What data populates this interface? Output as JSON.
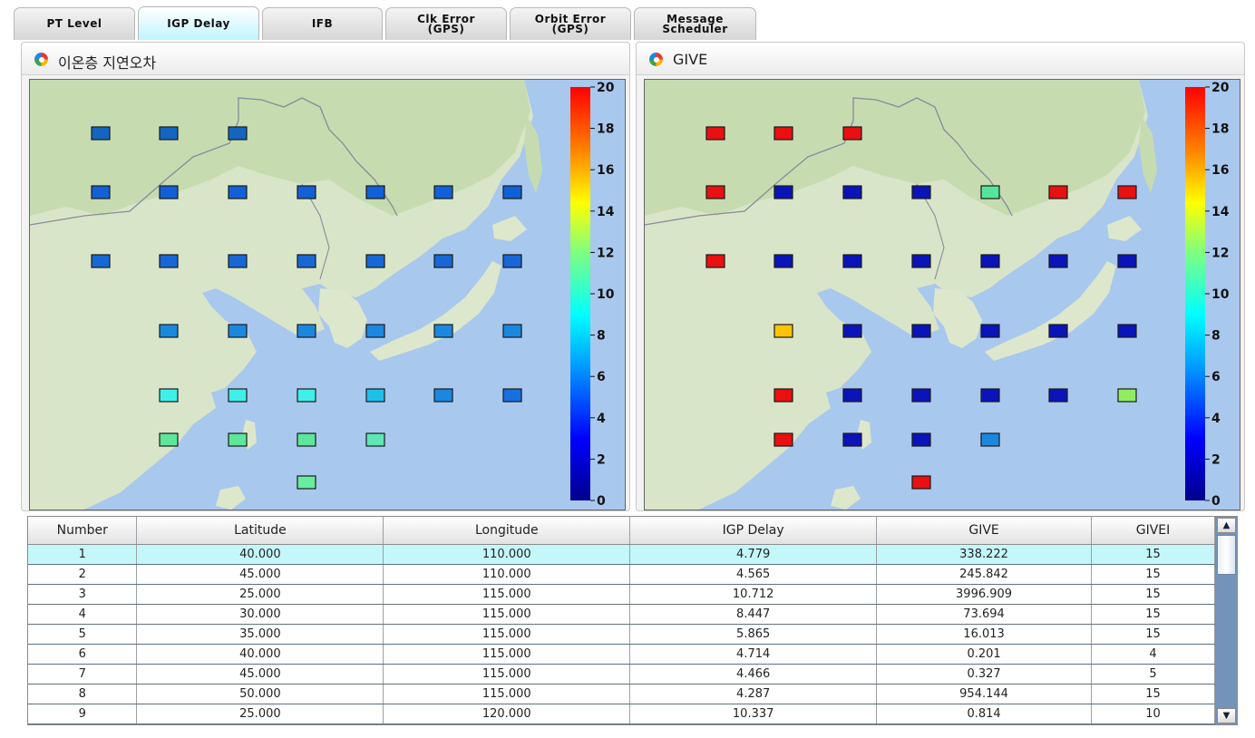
{
  "tabs": [
    {
      "label": "PT Level",
      "active": false
    },
    {
      "label": "IGP Delay",
      "active": true
    },
    {
      "label": "IFB",
      "active": false
    },
    {
      "label": "Clk Error\n(GPS)",
      "active": false
    },
    {
      "label": "Orbit Error\n(GPS)",
      "active": false
    },
    {
      "label": "Message\nScheduler",
      "active": false
    }
  ],
  "panels": {
    "left": {
      "title": "이온층 지연오차"
    },
    "right": {
      "title": "GIVE"
    }
  },
  "colorbar": {
    "ticks": [
      "0",
      "2",
      "4",
      "6",
      "8",
      "10",
      "12",
      "14",
      "16",
      "18",
      "20"
    ],
    "range": [
      0,
      20
    ]
  },
  "maps": {
    "left_colors": [
      [
        "#1565c0",
        "#1565c0",
        "#1565c0",
        null,
        null,
        null,
        null
      ],
      [
        "#1160d8",
        "#1160d8",
        "#1160d8",
        "#1160d8",
        "#1160d8",
        "#1160d8",
        "#1160d8"
      ],
      [
        "#1768d6",
        "#1768d6",
        "#1768d6",
        "#1768d6",
        "#1768d6",
        "#1768d6",
        "#1768d6"
      ],
      [
        null,
        "#1b88e0",
        "#1b88e0",
        "#1b88e0",
        "#1b88e0",
        "#1b88e0",
        "#1b88e0"
      ],
      [
        null,
        "#40f0e8",
        "#40f0e8",
        "#40f0e8",
        "#1fc0e8",
        "#1b88e0",
        "#1770e0"
      ],
      [
        null,
        "#5ee79a",
        "#5ee79a",
        "#5ee79a",
        "#5ee7b5",
        null,
        null
      ],
      [
        null,
        null,
        null,
        "#6aeca0",
        null,
        null,
        null
      ]
    ],
    "right_colors": [
      [
        "#e81010",
        "#e81010",
        "#e81010",
        null,
        null,
        null,
        null
      ],
      [
        "#e81010",
        "#0a14b8",
        "#0a14b8",
        "#0a14b8",
        "#55e59a",
        "#e81010",
        "#e81010"
      ],
      [
        "#e81010",
        "#0a14b8",
        "#0a14b8",
        "#0a14b8",
        "#0a14b8",
        "#0a14b8",
        "#0a14b8"
      ],
      [
        null,
        "#ffc400",
        "#0a14b8",
        "#0a14b8",
        "#0a14b8",
        "#0a14b8",
        "#0a14b8"
      ],
      [
        null,
        "#e81010",
        "#0a14b8",
        "#0a14b8",
        "#0a14b8",
        "#0a14b8",
        "#90ec60"
      ],
      [
        null,
        "#e81010",
        "#0a14b8",
        "#0a14b8",
        "#1b88e0",
        null,
        null
      ],
      [
        null,
        null,
        null,
        "#e81010",
        null,
        null,
        null
      ]
    ]
  },
  "table": {
    "columns": [
      "Number",
      "Latitude",
      "Longitude",
      "IGP Delay",
      "GIVE",
      "GIVEI"
    ],
    "rows": [
      [
        "1",
        "40.000",
        "110.000",
        "4.779",
        "338.222",
        "15"
      ],
      [
        "2",
        "45.000",
        "110.000",
        "4.565",
        "245.842",
        "15"
      ],
      [
        "3",
        "25.000",
        "115.000",
        "10.712",
        "3996.909",
        "15"
      ],
      [
        "4",
        "30.000",
        "115.000",
        "8.447",
        "73.694",
        "15"
      ],
      [
        "5",
        "35.000",
        "115.000",
        "5.865",
        "16.013",
        "15"
      ],
      [
        "6",
        "40.000",
        "115.000",
        "4.714",
        "0.201",
        "4"
      ],
      [
        "7",
        "45.000",
        "115.000",
        "4.466",
        "0.327",
        "5"
      ],
      [
        "8",
        "50.000",
        "115.000",
        "4.287",
        "954.144",
        "15"
      ],
      [
        "9",
        "25.000",
        "120.000",
        "10.337",
        "0.814",
        "10"
      ]
    ],
    "selected_row": 0
  },
  "scrollbar": {
    "up_icon": "▲",
    "down_icon": "▼"
  }
}
